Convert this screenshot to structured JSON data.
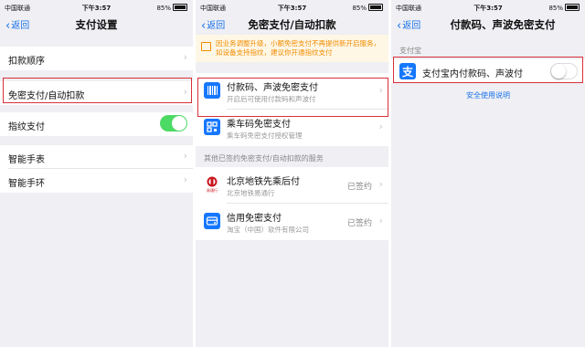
{
  "status_bar": {
    "carrier": "中国联通",
    "time": "下午3:57",
    "battery": "85%"
  },
  "screen1": {
    "back": "返回",
    "title": "支付设置",
    "items": [
      {
        "label": "扣款顺序"
      },
      {
        "label": "免密支付/自动扣款"
      },
      {
        "label": "指纹支付",
        "toggle": "on"
      },
      {
        "label": "智能手表"
      },
      {
        "label": "智能手环"
      }
    ]
  },
  "screen2": {
    "back": "返回",
    "title": "免密支付/自动扣款",
    "notice": "因业务调整升级，小额免密支付不再提供新开启服务，如设备支持指纹，建议你开通指纹支付",
    "items": [
      {
        "title": "付款码、声波免密支付",
        "subtitle": "开启后可使用付款码和声波付"
      },
      {
        "title": "乘车码免密支付",
        "subtitle": "乘车码免密支付授权管理"
      }
    ],
    "section_label": "其他已签约免密支付/自动扣款的服务",
    "services": [
      {
        "title": "北京地铁先乘后付",
        "subtitle": "北京地铁易通行",
        "status": "已签约"
      },
      {
        "title": "信用免密支付",
        "subtitle": "淘宝（中国）软件有限公司",
        "status": "已签约"
      }
    ],
    "logo_text": "易通行"
  },
  "screen3": {
    "back": "返回",
    "title": "付款码、声波免密支付",
    "section_label": "支付宝",
    "item": {
      "label": "支付宝内付款码、声波付",
      "toggle": "off"
    },
    "link": "安全使用说明"
  },
  "colors": {
    "accent": "#1a73e8",
    "highlight": "#d9303a",
    "toggle_on": "#4cd964",
    "notice_text": "#f08c00",
    "alipay": "#1677ff"
  },
  "icons": {
    "alipay_icon": "alipay-icon",
    "barcode_icon": "barcode-icon",
    "qr_icon": "bus-qr-icon",
    "metro_logo": "beijing-metro-logo",
    "credit_icon": "credit-icon"
  }
}
